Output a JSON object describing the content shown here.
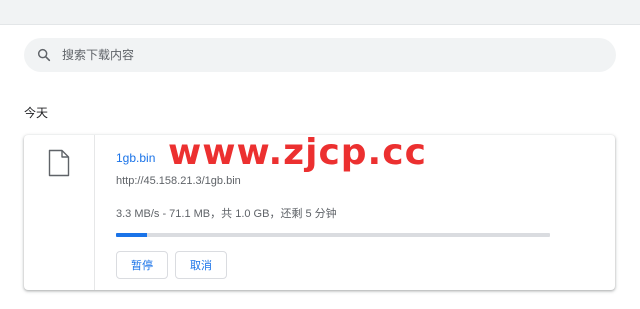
{
  "search": {
    "placeholder": "搜索下载内容",
    "icon": "search-icon"
  },
  "downloads": {
    "date_header": "今天",
    "items": [
      {
        "icon": "file-icon",
        "file_name": "1gb.bin",
        "url": "http://45.158.21.3/1gb.bin",
        "status": "3.3 MB/s - 71.1 MB，共 1.0 GB，还剩 5 分钟",
        "progress": 0.071,
        "pause_label": "暂停",
        "cancel_label": "取消"
      }
    ]
  },
  "watermark": {
    "text": "www.zjcp.cc"
  },
  "colors": {
    "accent": "#1a73e8",
    "watermark": "#ec3030",
    "secondary_text": "#5f6368",
    "search_bg": "#f1f3f4"
  }
}
